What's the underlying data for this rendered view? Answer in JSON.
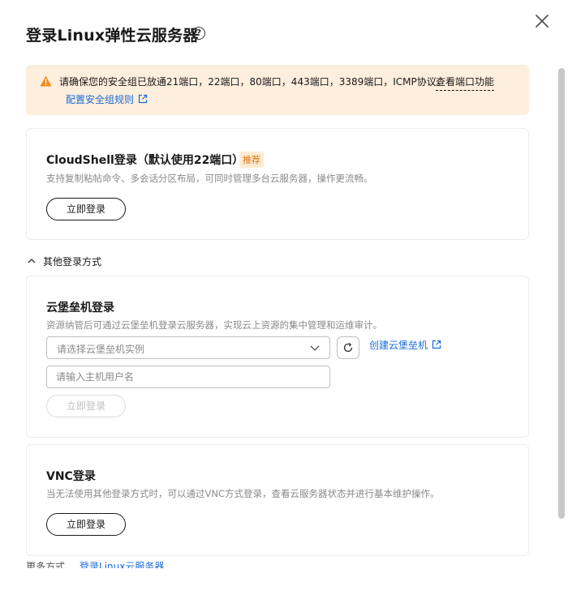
{
  "dialog": {
    "title": "登录Linux弹性云服务器",
    "help_glyph": "?"
  },
  "alert": {
    "message": "请确保您的安全组已放通21端口，22端口，80端口，443端口，3389端口，ICMP协议。",
    "link_ports": "查看端口功能",
    "link_rules": "配置安全组规则",
    "accent_color": "#f08c1e"
  },
  "cloudshell": {
    "title": "CloudShell登录（默认使用22端口）",
    "badge": "推荐",
    "description": "支持复制粘帖命令、多会话分区布局，可同时管理多台云服务器，操作更流畅。",
    "login_label": "立即登录"
  },
  "other_methods": {
    "toggle_label": "其他登录方式"
  },
  "bastion": {
    "title": "云堡垒机登录",
    "description": "资源纳管后可通过云堡垒机登录云服务器，实现云上资源的集中管理和运维审计。",
    "select_placeholder": "请选择云堡垒机实例",
    "create_link": "创建云堡垒机",
    "username_placeholder": "请输入主机用户名",
    "login_label": "立即登录"
  },
  "vnc": {
    "title": "VNC登录",
    "description": "当无法使用其他登录方式时，可以通过VNC方式登录，查看云服务器状态并进行基本维护操作。",
    "login_label": "立即登录"
  },
  "footer": {
    "more_label": "更多方式",
    "more_link": "登录Linux云服务器"
  },
  "theme": {
    "link_color": "#1a6bd8",
    "badge_color": "#d9730d"
  }
}
